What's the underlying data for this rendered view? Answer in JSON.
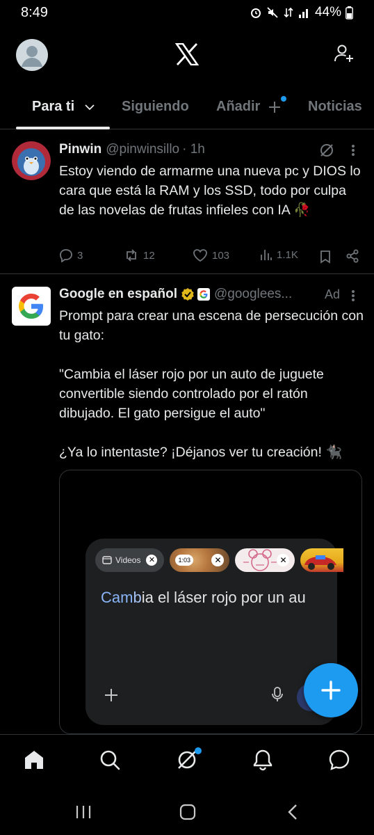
{
  "status": {
    "time": "8:49",
    "battery": "44%"
  },
  "tabs": [
    {
      "label": "Para ti",
      "active": true
    },
    {
      "label": "Siguiendo",
      "active": false
    },
    {
      "label": "Añadir",
      "active": false
    },
    {
      "label": "Noticias",
      "active": false
    }
  ],
  "tweets": [
    {
      "name": "Pinwin",
      "handle": "@pinwinsillo",
      "time": "· 1h",
      "text": "Estoy viendo de armarme una nueva pc y DIOS lo cara que está la RAM y los SSD, todo por culpa de las novelas de frutas infieles con IA 🥀",
      "replies": "3",
      "reposts": "12",
      "likes": "103",
      "views": "1.1K"
    },
    {
      "name": "Google en español",
      "handle": "@googlees...",
      "ad_label": "Ad",
      "text": "Prompt para crear una escena de persecución con tu gato:\n\n\"Cambia el láser rojo por un auto de juguete convertible siendo controlado por el ratón dibujado. El gato persigue el auto\"\n\n¿Ya lo intentaste? ¡Déjanos ver tu creación! 🐈‍⬛",
      "media": {
        "chip_label": "Videos",
        "thumb_label": "1:03",
        "prompt_highlight": "Cam",
        "prompt_mid": "b",
        "prompt_rest": "ia el láser rojo por un au"
      }
    }
  ],
  "colors": {
    "accent": "#1d9bf0",
    "muted": "#71767b",
    "text": "#e7e9ea"
  }
}
